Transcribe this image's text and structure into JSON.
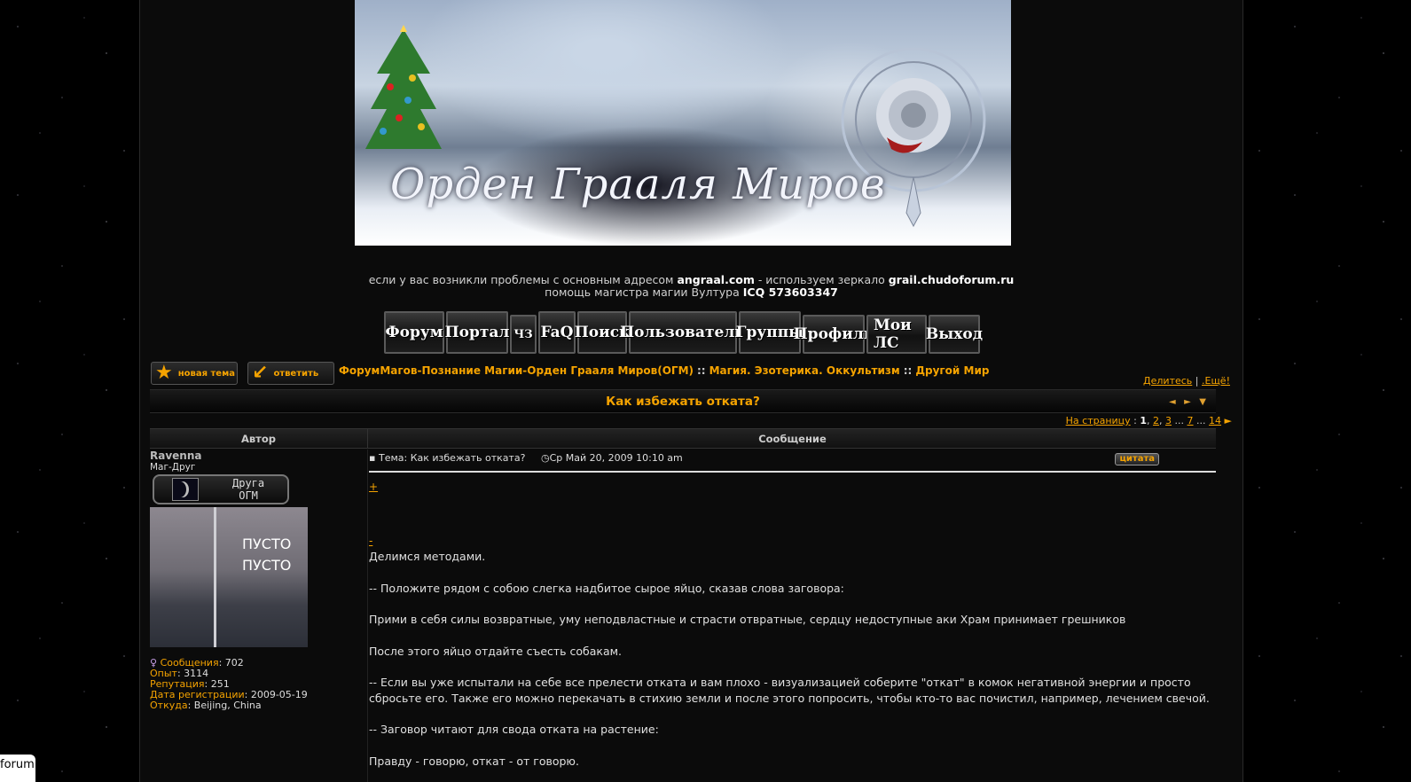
{
  "banner": {
    "title": "Орден Грааля Миров"
  },
  "notice": {
    "line1_prefix": "если у вас возникли проблемы с основным адресом",
    "main_domain": "angraal.com",
    "line1_middle": "- используем зеркало",
    "mirror_domain": "grail.chudoforum.ru",
    "line2_prefix": "помощь магистра магии Вултура",
    "icq": "ICQ 573603347"
  },
  "nav": [
    "Форум",
    "Портал",
    "ЧЗ",
    "FaQ",
    "Поиск",
    "Пользователи",
    "Группы",
    "Профиль",
    "Мои ЛС",
    "Выход"
  ],
  "actions": {
    "new_topic": "новая тема",
    "reply": "ответить"
  },
  "breadcrumb": [
    "ФорумМагов-Познание Магии-Орден Грааля Миров(ОГМ)",
    "Магия. Эзотерика. Оккультизм",
    "Другой Мир"
  ],
  "breadcrumb_sep": "::",
  "share": {
    "share_label": "Делитесь",
    "sep": "|",
    "more_label": ".Ещё!"
  },
  "topic": {
    "title": "Как избежать отката?",
    "arrows": "◄ ► ▼"
  },
  "pager": {
    "label": "На страницу",
    "current": "1",
    "pages": [
      "2",
      "3",
      "7",
      "14"
    ],
    "ellipsis": "...",
    "next": "►"
  },
  "table": {
    "author_header": "Автор",
    "message_header": "Сообщение"
  },
  "author": {
    "name": "Ravenna",
    "rank": "Маг-Друг",
    "rank_badge_line1": "Друга",
    "rank_badge_line2": "ОГМ",
    "avatar_text1": "ПУСТО",
    "avatar_text2": "ПУСТО",
    "stats": {
      "posts_label": "Сообщения",
      "posts": "702",
      "exp_label": "Опыт",
      "exp": "3114",
      "rep_label": "Репутация",
      "rep": "251",
      "reg_label": "Дата регистрации",
      "reg": "2009-05-19",
      "from_label": "Откуда",
      "from": "Beijing, China"
    }
  },
  "post": {
    "subject_prefix": "Тема:",
    "subject": "Как избежать отката?",
    "date": "Ср Май 20, 2009 10:10 am",
    "quote_label": "цитата",
    "spoiler_open": "+",
    "spoiler_close": "-",
    "paragraphs": [
      "Делимся методами.",
      "-- Положите рядом с собою слегка надбитое сырое яйцо, сказав слова заговора:",
      "Прими в себя силы возвратные, уму неподвластные и страсти отвратные, сердцу недоступные аки Храм принимает грешников",
      "После этого яйцо отдайте съесть собакам.",
      "-- Если вы уже испытали на себе все прелести отката и вам плохо - визуализацией соберите \"откат\" в комок негативной энергии и просто сбросьте его. Также его можно перекачать в стихию земли и после этого попросить, чтобы кто-то вас почистил, например, лечением свечой.",
      "-- Заговор читают для свода отката на растение:",
      "Правду - говорю, откат - от говорю."
    ]
  },
  "tooltip": "forum"
}
